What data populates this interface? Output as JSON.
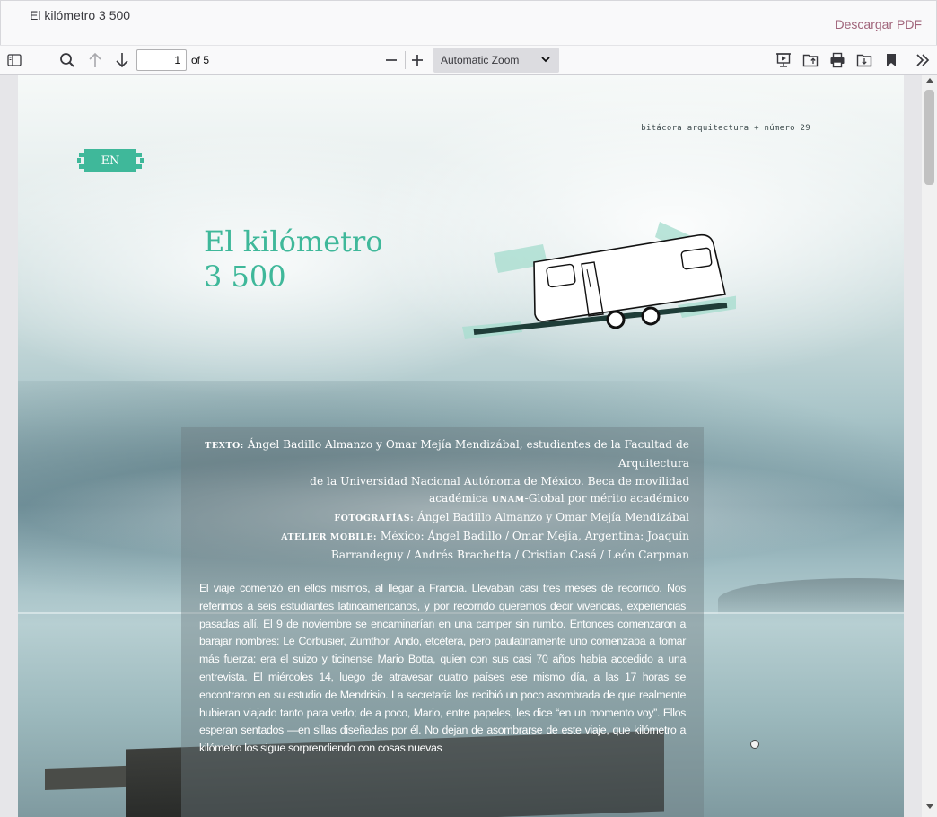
{
  "header": {
    "title": "El kilómetro 3 500",
    "download_label": "Descargar PDF"
  },
  "toolbar": {
    "page_current": "1",
    "page_count_label": "of 5",
    "zoom_label": "Automatic Zoom",
    "icons": [
      "sidebar-toggle-icon",
      "search-icon",
      "previous-page-icon",
      "next-page-icon",
      "zoom-out-icon",
      "zoom-in-icon",
      "presentation-mode-icon",
      "open-file-icon",
      "print-icon",
      "save-icon",
      "bookmark-icon",
      "tools-icon"
    ]
  },
  "document": {
    "journal_header": "bitácora arquitectura + número 29",
    "lang_badge": "EN",
    "title_line1": "El kilómetro",
    "title_line2": "3 500",
    "credits": {
      "texto_key": "texto:",
      "texto_line1": "Ángel Badillo Almanzo y Omar Mejía Mendizábal, estudiantes de la Facultad de Arquitectura",
      "texto_line2": "de la Universidad Nacional Autónoma de México. Beca de movilidad",
      "texto_line3_a": "académica",
      "texto_line3_b": "unam",
      "texto_line3_c": "-Global por mérito académico",
      "fotos_key": "fotografías:",
      "fotos_value": "Ángel Badillo Almanzo y Omar Mejía Mendizábal",
      "atelier_key": "atelier mobile:",
      "atelier_line1": "México: Ángel Badillo / Omar Mejía, Argentina: Joaquín",
      "atelier_line2": "Barrandeguy / Andrés Brachetta / Cristian Casá / León Carpman"
    },
    "body": "El viaje comenzó en ellos mismos, al llegar a Francia. Llevaban casi tres meses de recorrido. Nos referimos a seis estudiantes latinoamericanos, y por recorrido queremos decir vivencias, experiencias pasadas allí. El 9 de noviembre se encaminarían en una camper sin rumbo. Entonces comenzaron a barajar nombres: Le Corbusier, Zumthor, Ando, etcétera, pero paulatinamente uno comenzaba a tomar más fuerza: era el suizo y ticinense Mario Botta, quien con sus casi 70 años había accedido a una entrevista. El miércoles 14, luego de atravesar cuatro países ese mismo día, a las 17 horas se encontraron en su estudio de Mendrisio. La secretaria los recibió un poco asombrada de que realmente hubieran viajado tanto para verlo; de a poco, Mario, entre papeles, les dice “en un momento voy”. Ellos esperan sentados —en sillas diseñadas por él. No dejan de asombrarse de este viaje, que kilómetro a kilómetro los sigue sorprendiendo con cosas nuevas"
  },
  "colors": {
    "accent_teal": "#3fb89a",
    "download_link": "#a0647a",
    "toolbar_bg": "#f9f9fa"
  }
}
